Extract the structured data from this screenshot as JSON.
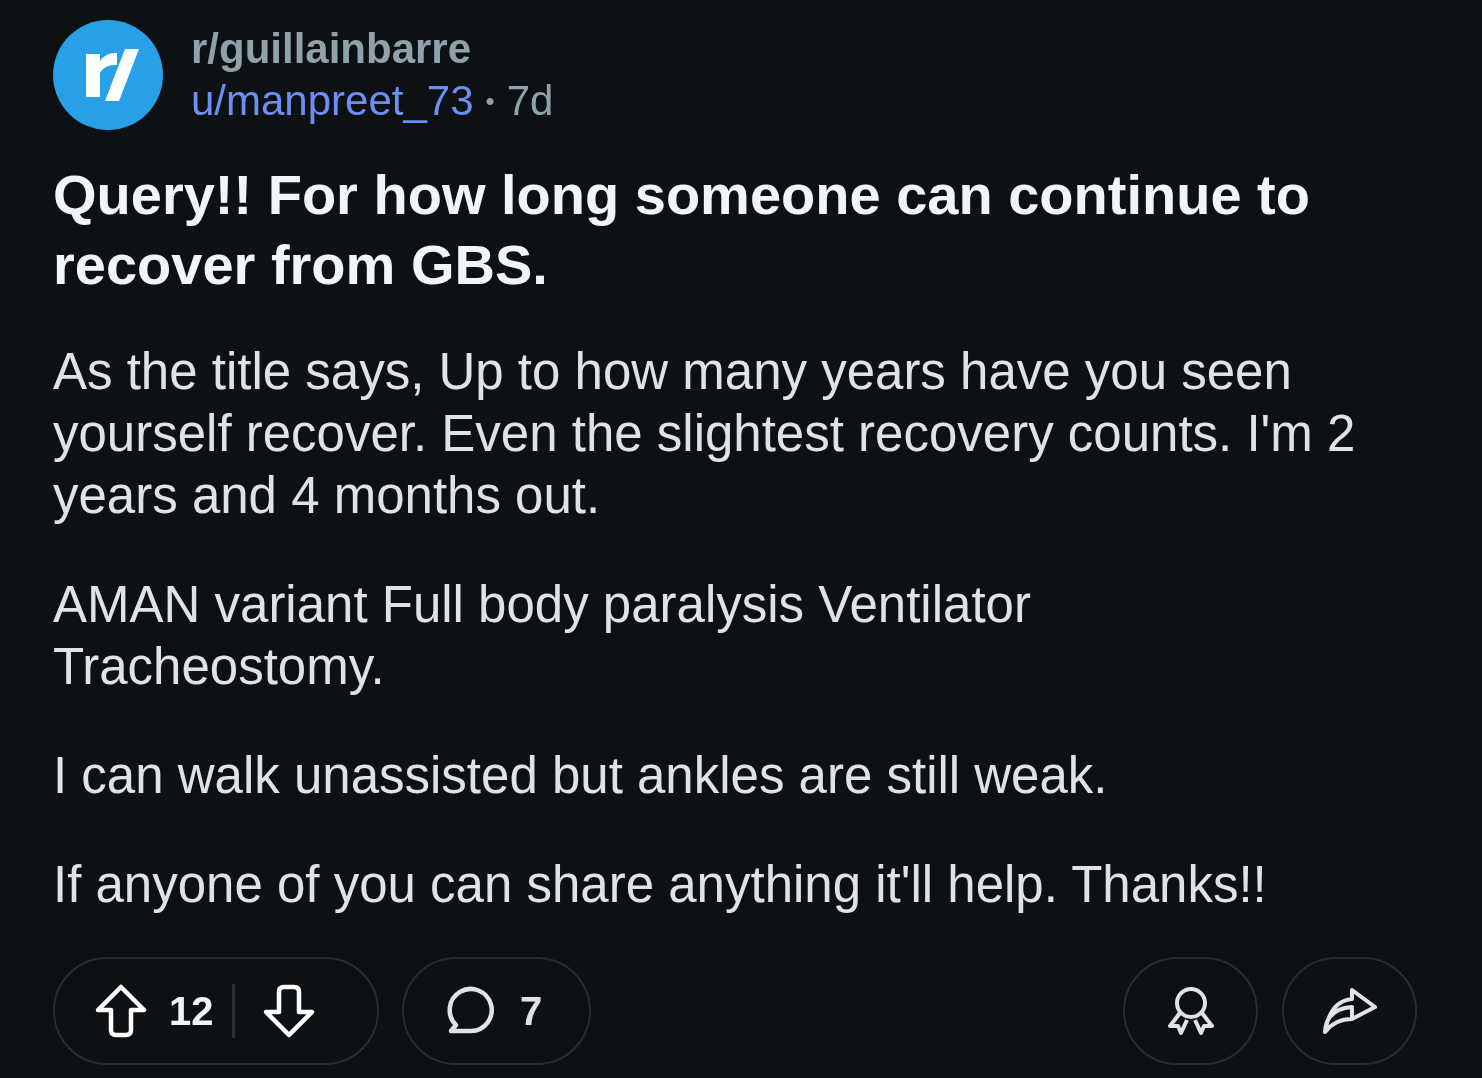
{
  "post": {
    "subreddit": "r/guillainbarre",
    "author": "u/manpreet_73",
    "separator": "•",
    "age": "7d",
    "title": "Query!! For how long someone can continue to recover from GBS.",
    "body": [
      "As the title says, Up to how many years have you seen yourself recover. Even the slightest recovery counts. I'm 2 years and 4 months out.",
      "AMAN variant Full body paralysis Ventilator Tracheostomy.",
      "I can walk unassisted but ankles are still weak.",
      "If anyone of you can share anything it'll help. Thanks!!"
    ],
    "actions": {
      "score": "12",
      "comments": "7"
    }
  }
}
